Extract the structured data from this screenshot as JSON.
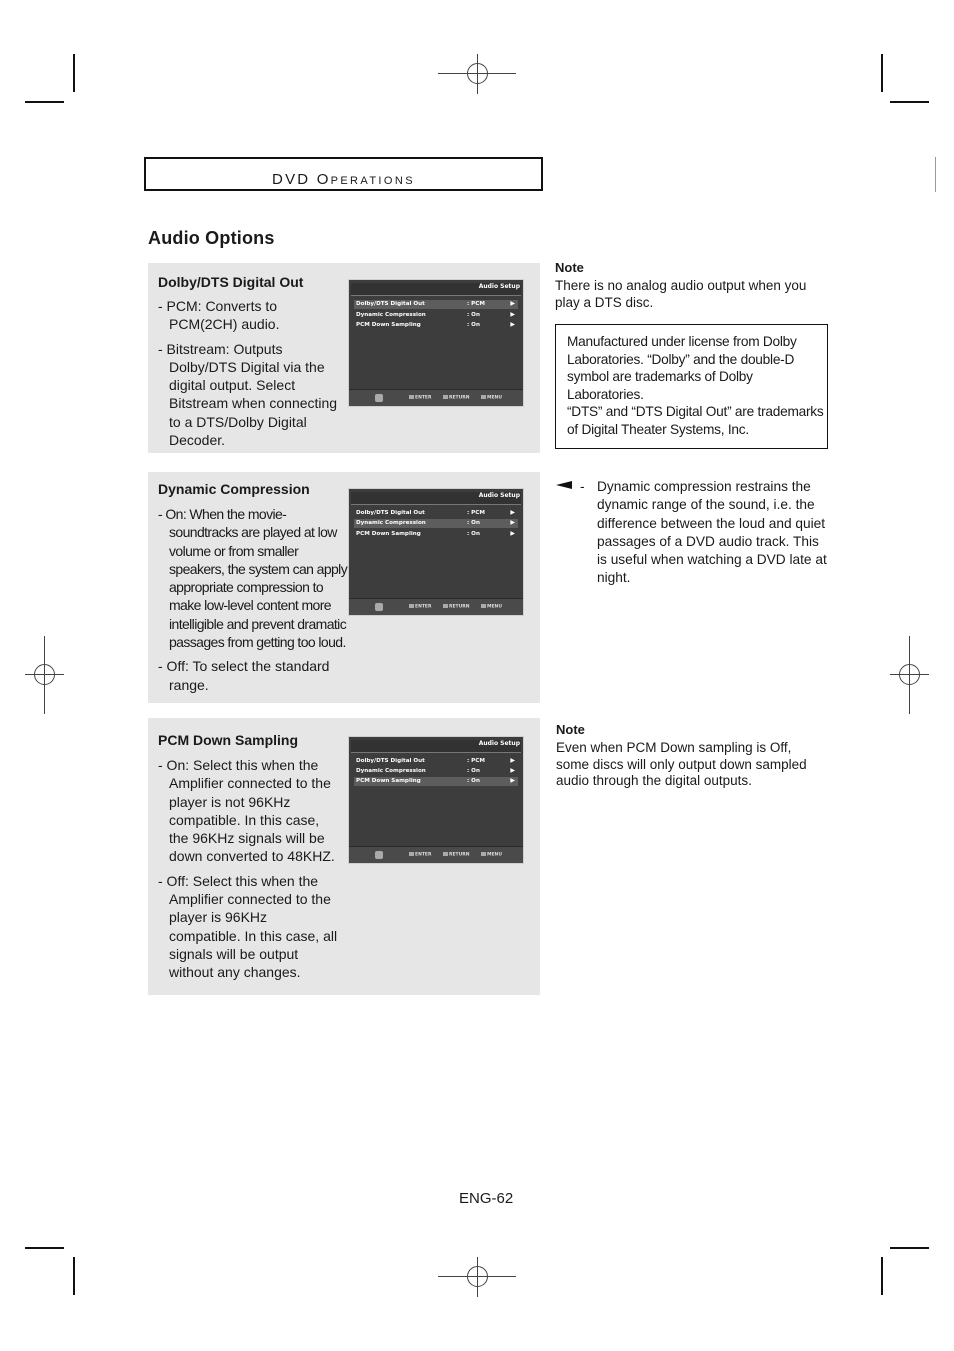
{
  "header": {
    "section_first": "D",
    "section_rest": "VD O",
    "section_caps": "PERATIONS",
    "section_label": "DVD Operations"
  },
  "page_title": "Audio Options",
  "panels": [
    {
      "title": "Dolby/DTS Digital Out",
      "items": [
        "- PCM: Converts to PCM(2CH) audio.",
        "- Bitstream: Outputs Dolby/DTS Digital via the digital output. Select Bitstream when connecting to a DTS/Dolby Digital Decoder."
      ],
      "osd_selected": 0
    },
    {
      "title": "Dynamic Compression",
      "items": [
        "- On: When the movie-soundtracks are played at low volume or from smaller speakers, the system can apply appropriate compression to make low-level content more intelligible and prevent dramatic passages from getting too loud.",
        "- Off: To select the standard range."
      ],
      "osd_selected": 1
    },
    {
      "title": "PCM Down Sampling",
      "items": [
        "- On: Select this when the Amplifier connected to the player is not 96KHz compatible. In this case, the 96KHz signals will be down converted to 48KHZ.",
        "- Off: Select this when the Amplifier connected to the player is 96KHz compatible. In this case, all signals will be output without any changes."
      ],
      "osd_selected": 2
    }
  ],
  "osd": {
    "title": "Audio Setup",
    "rows": [
      {
        "label": "Dolby/DTS Digital Out",
        "value": ": PCM",
        "arrow": "▶"
      },
      {
        "label": "Dynamic Compression",
        "value": ": On",
        "arrow": "▶"
      },
      {
        "label": "PCM Down Sampling",
        "value": ": On",
        "arrow": "▶"
      }
    ],
    "footer": {
      "enter": "ENTER",
      "return": "RETURN",
      "menu": "MENU"
    }
  },
  "notes": {
    "note1_heading": "Note",
    "note1_text": "There is no analog audio output when you play a DTS disc.",
    "license_line1": "Manufactured under license from Dolby Laboratories. “Dolby” and the double-D symbol are trademarks of Dolby Laboratories.",
    "license_line2": "“DTS” and “DTS Digital Out” are trademarks of Digital Theater Systems, Inc.",
    "dynamic_dash": "-",
    "dynamic_text": "Dynamic compression restrains the dynamic range of the sound, i.e. the difference between the loud and quiet passages of a DVD audio track. This is useful when watching a DVD late at night.",
    "note2_heading": "Note",
    "note2_text": "Even when PCM Down sampling is Off, some discs will only output down sampled audio through the digital outputs."
  },
  "page_number": "ENG-62"
}
